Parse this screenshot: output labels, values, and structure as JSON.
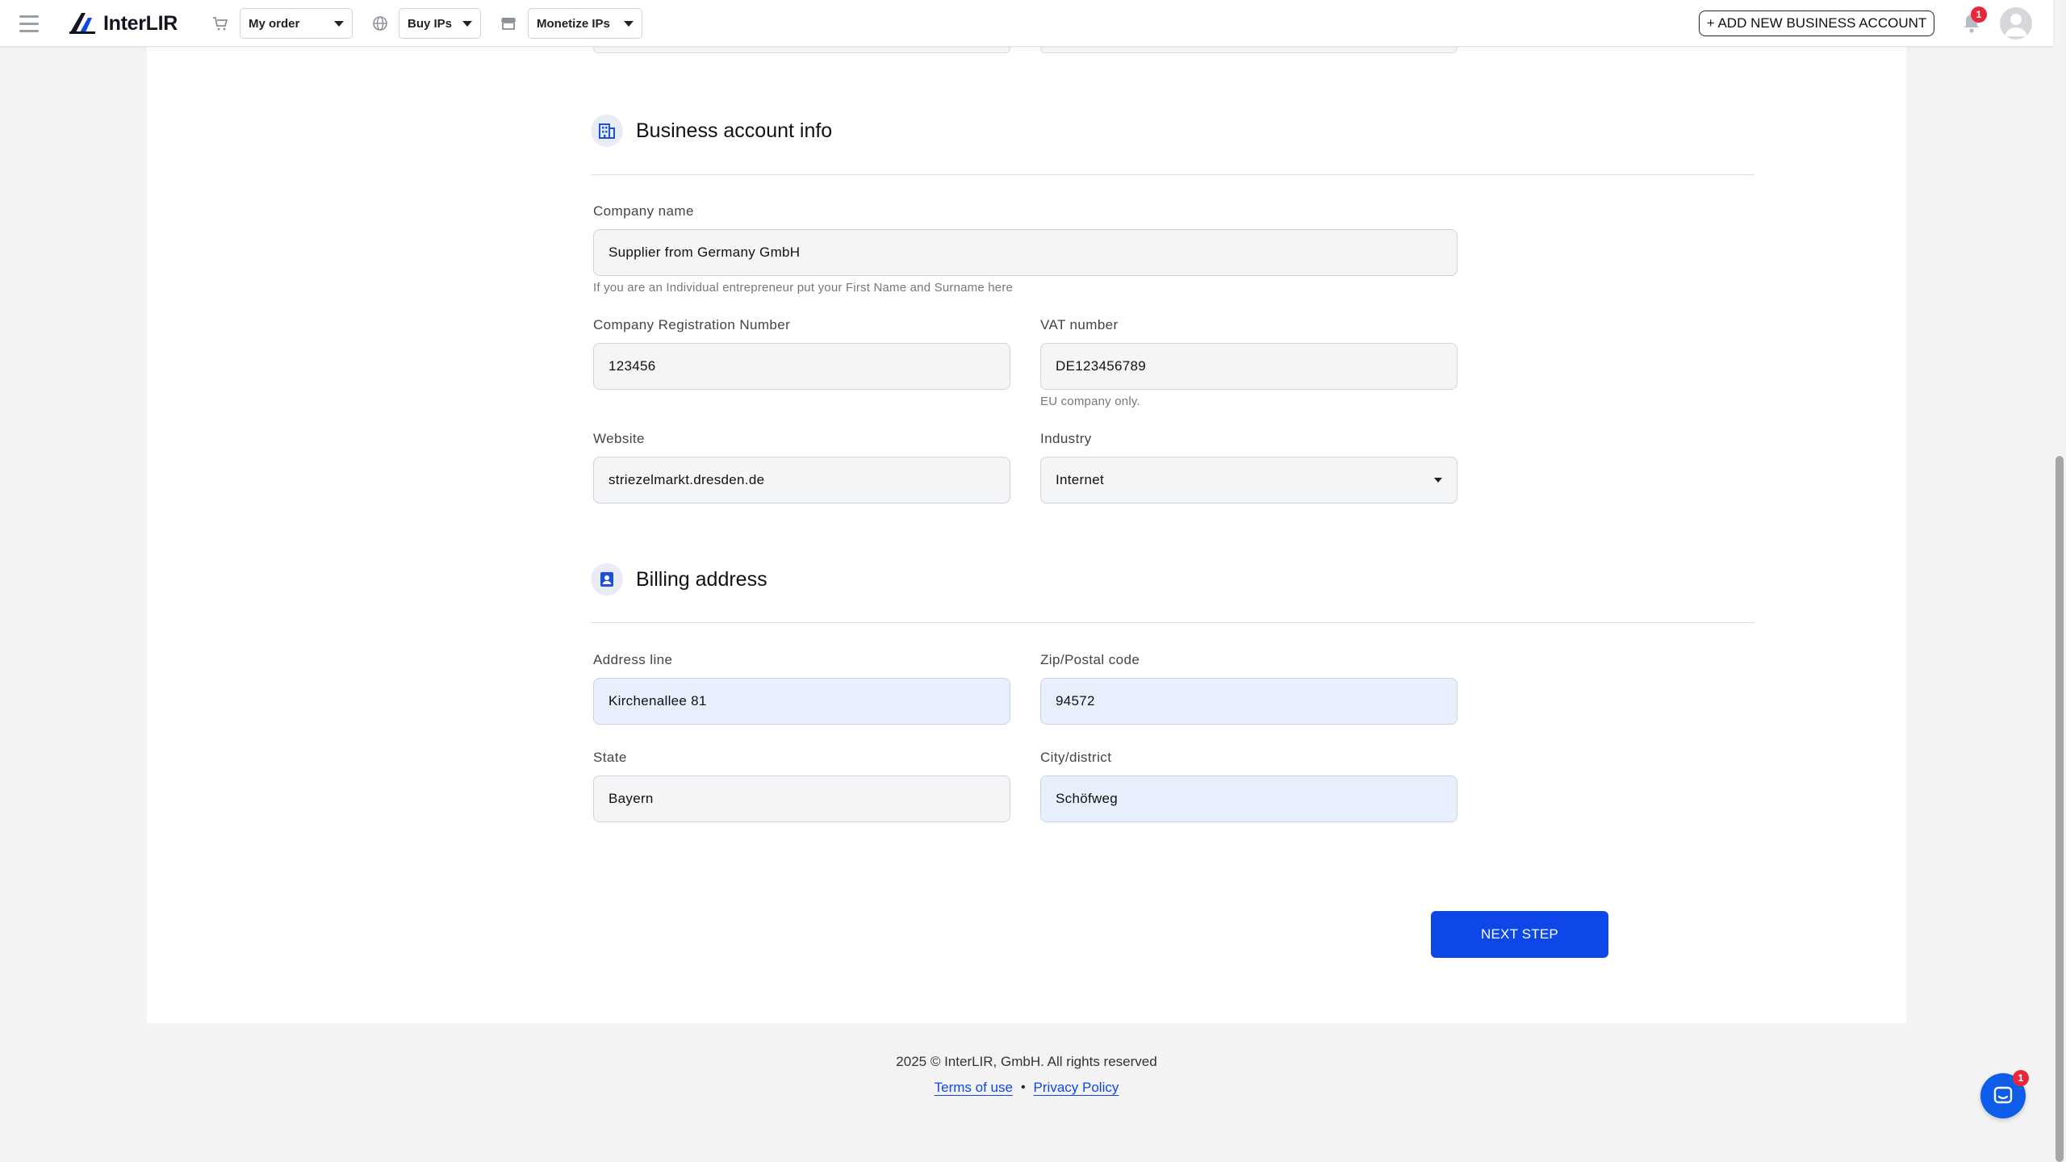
{
  "header": {
    "logo_text": "InterLIR",
    "nav": [
      {
        "icon": "cart-icon",
        "label": "My order"
      },
      {
        "icon": "globe-icon",
        "label": "Buy IPs"
      },
      {
        "icon": "store-icon",
        "label": "Monetize IPs"
      }
    ],
    "add_account_label": "+ ADD NEW BUSINESS ACCOUNT",
    "notification_count": "1"
  },
  "business_section": {
    "title": "Business account info",
    "company_name": {
      "label": "Company name",
      "value": "Supplier from Germany GmbH",
      "hint": "If you are an Individual entrepreneur put your First Name and Surname here"
    },
    "registration_number": {
      "label": "Company Registration Number",
      "value": "123456"
    },
    "vat_number": {
      "label": "VAT number",
      "value": "DE123456789",
      "hint": "EU company only."
    },
    "website": {
      "label": "Website",
      "value": "striezelmarkt.dresden.de"
    },
    "industry": {
      "label": "Industry",
      "value": "Internet"
    }
  },
  "billing_section": {
    "title": "Billing address",
    "address_line": {
      "label": "Address line",
      "value": "Kirchenallee 81"
    },
    "zip_code": {
      "label": "Zip/Postal code",
      "value": "94572"
    },
    "state": {
      "label": "State",
      "value": "Bayern"
    },
    "city": {
      "label": "City/district",
      "value": "Schöfweg"
    }
  },
  "next_button_label": "NEXT STEP",
  "footer": {
    "copyright": "2025 © InterLIR, GmbH. All rights reserved",
    "terms_label": "Terms of use",
    "separator": "•",
    "privacy_label": "Privacy Policy"
  },
  "chat_badge_count": "1",
  "colors": {
    "accent": "#0d47e8",
    "badge": "#e8283a",
    "autofill": "#e8effd"
  }
}
